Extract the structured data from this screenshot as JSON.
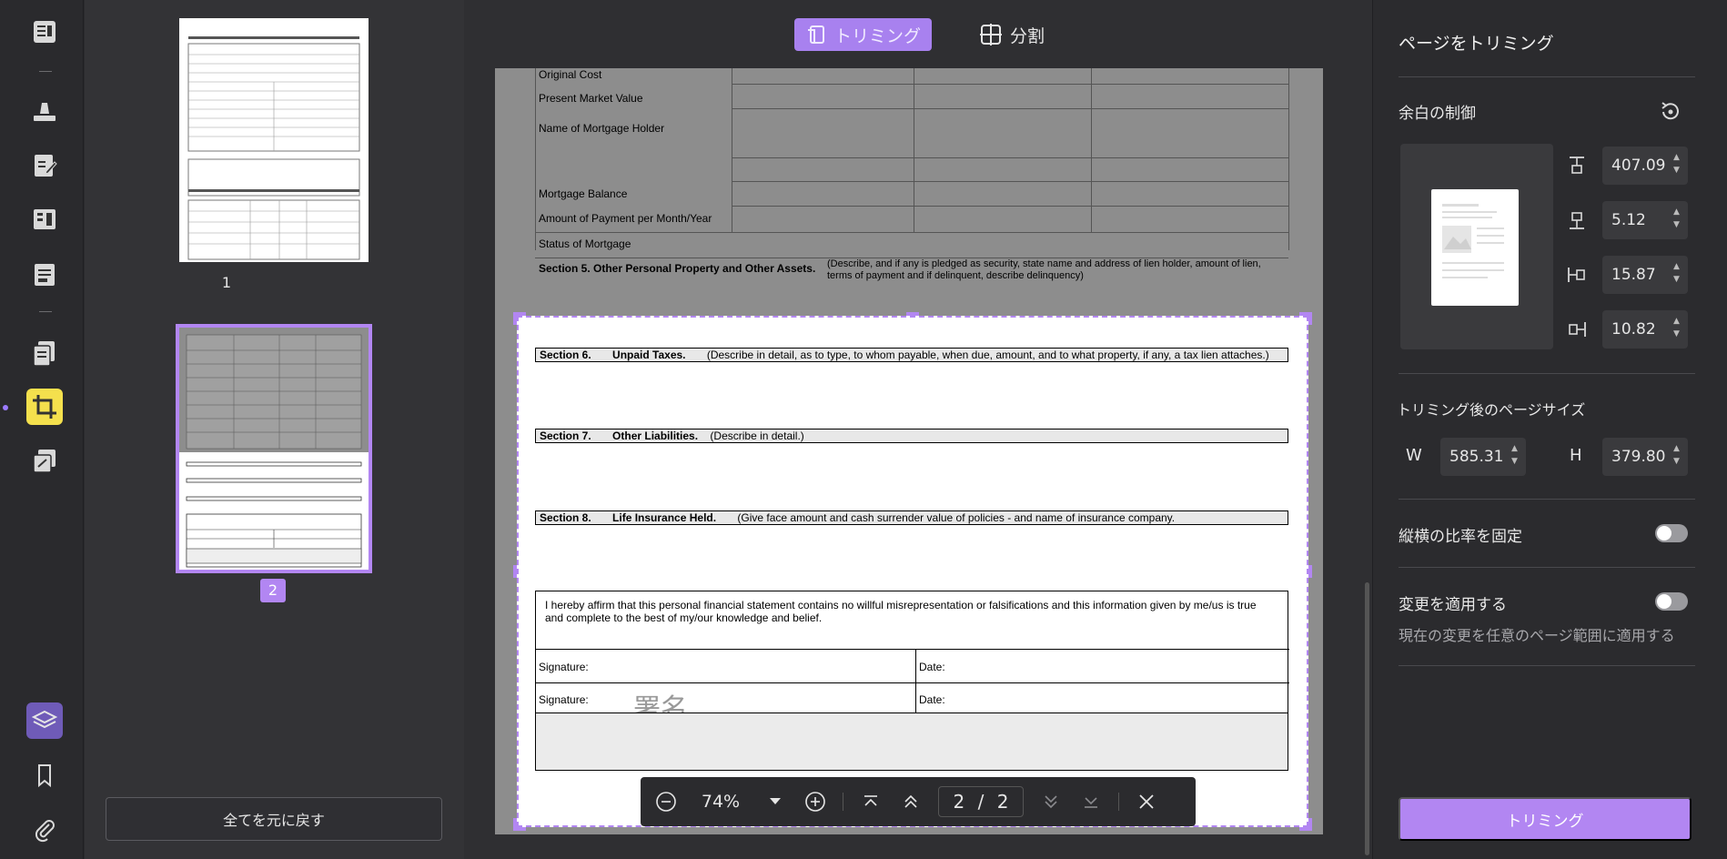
{
  "toolbar": {
    "items": [
      "reader-icon",
      "highlighter-icon",
      "edit-icon",
      "organize-icon",
      "form-icon",
      "convert-icon",
      "crop-icon",
      "compress-icon"
    ],
    "bottom": [
      "layers-icon",
      "bookmark-icon",
      "attachment-icon"
    ]
  },
  "thumbnails": {
    "pages": [
      {
        "number": "1"
      },
      {
        "number": "2"
      }
    ],
    "reset_all": "全てを元に戻す"
  },
  "mode_tabs": {
    "crop": "トリミング",
    "split": "分割"
  },
  "document": {
    "rows": [
      "Original Cost",
      "Present Market Value",
      "Name of Mortgage Holder",
      "Mortgage Balance",
      "Amount of Payment per Month/Year",
      "Status of Mortgage"
    ],
    "section5_title": "Section 5. Other Personal Property and Other Assets.",
    "section5_desc": "(Describe, and if any is pledged as security, state name and address of lien holder, amount of lien, terms of payment and if delinquent, describe delinquency)",
    "section6_num": "Section 6.",
    "section6_title": "Unpaid Taxes.",
    "section6_desc": "(Describe in detail, as to type, to whom payable, when due, amount, and to what property, if any, a tax lien attaches.)",
    "section7_num": "Section 7.",
    "section7_title": "Other Liabilities.",
    "section7_desc": "(Describe in detail.)",
    "section8_num": "Section 8.",
    "section8_title": "Life Insurance Held.",
    "section8_desc": "(Give face amount and cash surrender value of policies - and name of insurance company.",
    "affirm": "I hereby affirm that this personal financial statement contains no willful misrepresentation or falsifications and this information given by me/us is true and complete to the best of my/our knowledge and belief.",
    "signature_label": "Signature:",
    "date_label": "Date:",
    "signature_value": "署名"
  },
  "bottom_bar": {
    "zoom": "74%",
    "page_current": "2",
    "page_sep": "/",
    "page_total": "2"
  },
  "right_panel": {
    "title": "ページをトリミング",
    "margin_section": "余白の制御",
    "margins": {
      "top": "407.09",
      "bottom": "5.12",
      "left": "15.87",
      "right": "10.82"
    },
    "size_section": "トリミング後のページサイズ",
    "width_label": "W",
    "width": "585.31",
    "height_label": "H",
    "height": "379.80",
    "lock_ratio": "縦横の比率を固定",
    "apply_changes": "変更を適用する",
    "apply_desc": "現在の変更を任意のページ範囲に適用する",
    "trim_button": "トリミング"
  },
  "colors": {
    "accent": "#b286f2",
    "active_tool": "#f4e04d"
  }
}
